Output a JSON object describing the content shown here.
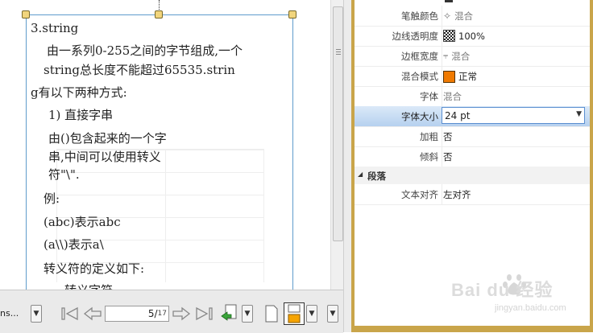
{
  "document": {
    "lines": [
      "3.string",
      "由一系列0-255之间的字节组成,一个",
      "string总长度不能超过65535.strin",
      "g有以下两种方式:",
      "1) 直接字串",
      "由()包含起来的一个字",
      "串,中间可以使用转义",
      "符\"\\\".",
      "例:",
      "(abc)表示abc",
      "(a\\\\)表示a\\",
      "转义符的定义如下:",
      "转义字符"
    ]
  },
  "toolbar": {
    "zoom_text": "ns...",
    "page_current": "5",
    "page_total": "17"
  },
  "properties": {
    "rows": [
      {
        "label": "笔触颜色",
        "value": "混合"
      },
      {
        "label": "边线透明度",
        "value": "100%"
      },
      {
        "label": "边框宽度",
        "value": "混合"
      },
      {
        "label": "混合模式",
        "value": "正常"
      },
      {
        "label": "字体",
        "value": "混合"
      },
      {
        "label": "字体大小",
        "value": "24 pt"
      },
      {
        "label": "加粗",
        "value": "否"
      },
      {
        "label": "倾斜",
        "value": "否"
      }
    ],
    "section": "段落",
    "align_label": "文本对齐",
    "align_value": "左对齐"
  },
  "colors": {
    "blend_swatch": "#f07a00",
    "panel_frame": "#c9a54a",
    "selection_border": "#5f9ccc"
  },
  "watermark": {
    "brand": "Bai du 经验",
    "url": "jingyan.baidu.com"
  }
}
